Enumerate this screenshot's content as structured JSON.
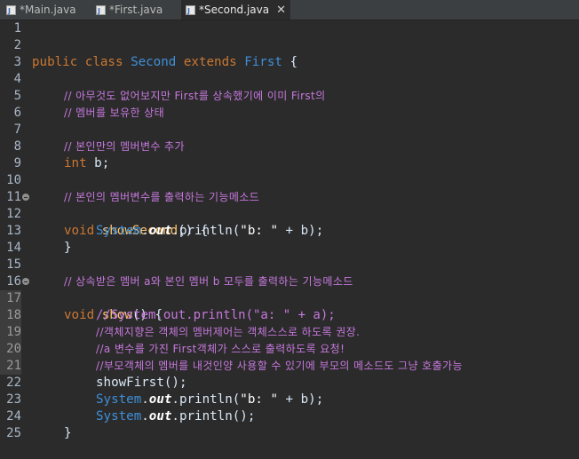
{
  "tabs": [
    {
      "label": "*Main.java",
      "active": false
    },
    {
      "label": "*First.java",
      "active": false
    },
    {
      "label": "*Second.java",
      "active": true
    }
  ],
  "lines": {
    "l2": {
      "kw1": "public",
      "kw2": "class",
      "cls": "Second",
      "kw3": "extends",
      "parent": "First",
      "brace": "{"
    },
    "l4": "// 아무것도 없어보지만 First를 상속했기에 이미 First의",
    "l5": "// 멤버를 보유한 상태",
    "l7": "// 본인만의 멤버변수 추가",
    "l8": {
      "kw": "int",
      "rest": "b;"
    },
    "l10": "// 본인의 멤버변수를 출력하는 기능메소드",
    "l11": {
      "kw": "void",
      "meth": "showSecond",
      "rest": "() {"
    },
    "l12": {
      "sys": "System",
      "dot1": ".",
      "field": "out",
      "rest1": ".println(",
      "str": "\"b: \"",
      "rest2": " + b);"
    },
    "l13": "}",
    "l15": "// 상속받은 멤버 a와 본인 멤버 b 모두를 출력하는 기능메소드",
    "l16": {
      "kw": "void",
      "meth": "show",
      "rest": "() {"
    },
    "l17": "//System.out.println(\"a: \" + a);",
    "l18": "//객체지향은 객체의 멤버제어는 객체스스로 하도록 권장.",
    "l19": "//a 변수를 가진 First객체가 스스로 출력하도록 요청!",
    "l20": "//부모객체의 멤버를 내것인양 사용할 수 있기에 부모의 메소드도 그냥 호출가능",
    "l21": "showFirst();",
    "l22": {
      "sys": "System",
      "dot1": ".",
      "field": "out",
      "rest1": ".println(",
      "str": "\"b: \"",
      "rest2": " + b);"
    },
    "l23": {
      "sys": "System",
      "dot1": ".",
      "field": "out",
      "rest1": ".println();"
    },
    "l24": "}"
  },
  "line_numbers": [
    "1",
    "2",
    "3",
    "4",
    "5",
    "6",
    "7",
    "8",
    "9",
    "10",
    "11",
    "12",
    "13",
    "14",
    "15",
    "16",
    "17",
    "18",
    "19",
    "20",
    "21",
    "22",
    "23",
    "24",
    "25"
  ]
}
